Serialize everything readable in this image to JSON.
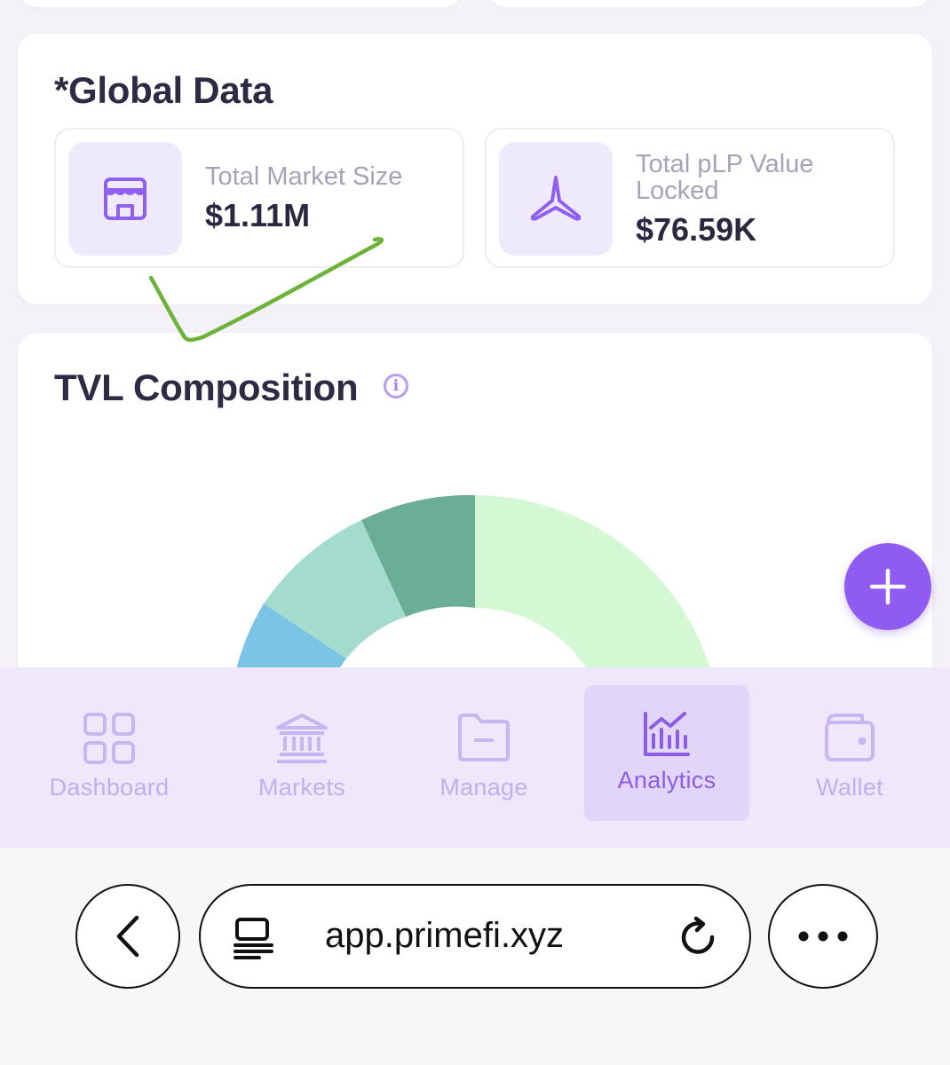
{
  "global_data": {
    "title": "*Global Data",
    "stats": [
      {
        "icon": "storefront-icon",
        "label": "Total Market Size",
        "value": "$1.11M"
      },
      {
        "icon": "tripod-icon",
        "label_line1": "Total pLP Value",
        "label_line2": "Locked",
        "value": "$76.59K"
      }
    ]
  },
  "tvl": {
    "title": "TVL Composition",
    "info_icon": "info-icon"
  },
  "chart_data": {
    "type": "pie",
    "title": "TVL Composition",
    "segments_visible_colors": [
      "#d3f8d3",
      "#6aae96",
      "#a3dccc",
      "#7ac4e6"
    ],
    "note_visible": "donut partially hidden behind navigation"
  },
  "fab": {
    "icon": "plus-icon"
  },
  "tabs": [
    {
      "label": "Dashboard",
      "icon": "grid-icon",
      "active": false
    },
    {
      "label": "Markets",
      "icon": "bank-icon",
      "active": false
    },
    {
      "label": "Manage",
      "icon": "folder-icon",
      "active": false
    },
    {
      "label": "Analytics",
      "icon": "chart-icon",
      "active": true
    },
    {
      "label": "Wallet",
      "icon": "wallet-icon",
      "active": false
    }
  ],
  "browser": {
    "url": "app.primefi.xyz",
    "back_icon": "back-icon",
    "reader_icon": "reader-icon",
    "reload_icon": "reload-icon",
    "more_icon": "more-icon"
  },
  "colors": {
    "accent": "#8f5bf0",
    "tab_bg": "#efe8fb",
    "annotation": "#6cb33a"
  }
}
